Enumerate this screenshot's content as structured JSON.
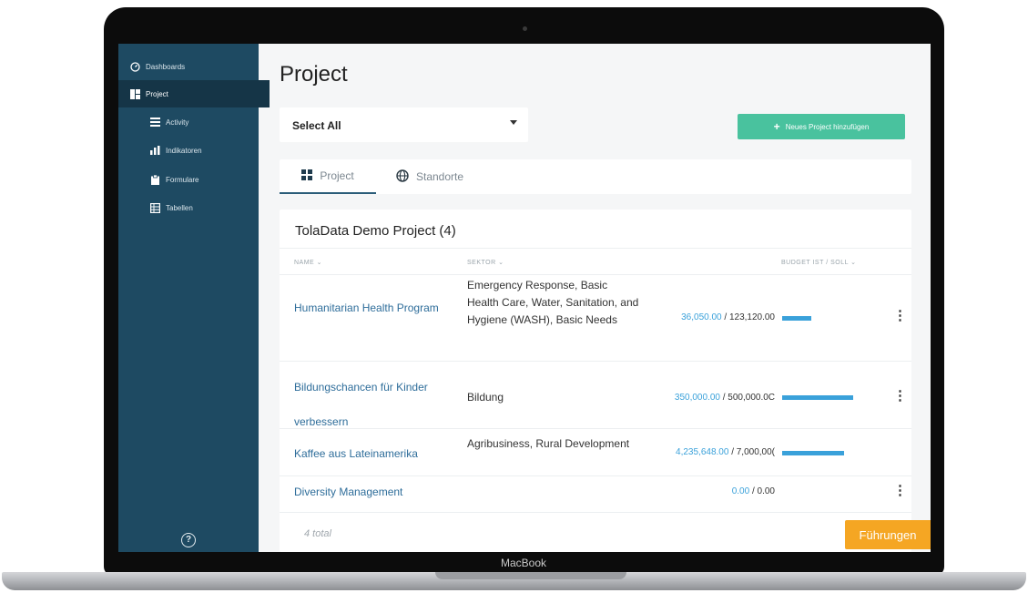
{
  "device": {
    "label": "MacBook"
  },
  "sidebar": {
    "items": [
      {
        "label": "Dashboards",
        "icon": "dashboard-icon"
      },
      {
        "label": "Project",
        "icon": "grid-icon"
      },
      {
        "label": "Activity",
        "icon": "list-icon"
      },
      {
        "label": "Indikatoren",
        "icon": "bar-chart-icon"
      },
      {
        "label": "Formulare",
        "icon": "clipboard-icon"
      },
      {
        "label": "Tabellen",
        "icon": "table-icon"
      }
    ],
    "help_icon": "help-icon"
  },
  "page": {
    "title": "Project"
  },
  "filter": {
    "selected": "Select All"
  },
  "actions": {
    "add_label": "Neues Project hinzufügen"
  },
  "tabs": [
    {
      "label": "Project",
      "icon": "grid-icon"
    },
    {
      "label": "Standorte",
      "icon": "globe-icon"
    }
  ],
  "card": {
    "title": "TolaData Demo Project (4)",
    "columns": {
      "name": "NAME ⌄",
      "sektor": "SEKTOR ⌄",
      "budget": "BUDGET IST / SOLL ⌄"
    },
    "rows": [
      {
        "name": "Humanitarian Health Program",
        "sektor": "Emergency Response, Basic Health Care, Water, Sanitation, and Hygiene (WASH), Basic Needs",
        "ist": "36,050.00",
        "soll": "/ 123,120.00",
        "progress": 0.29
      },
      {
        "name": "Bildungschancen für Kinder verbessern",
        "sektor": "Bildung",
        "ist": "350,000.00",
        "soll": "/ 500,000.0C",
        "progress": 0.7
      },
      {
        "name": "Kaffee aus Lateinamerika",
        "sektor": "Agribusiness, Rural Development",
        "ist": "4,235,648.00",
        "soll": "/ 7,000,00(",
        "progress": 0.61
      },
      {
        "name": "Diversity Management",
        "sektor": "",
        "ist": "0.00",
        "soll": "/ 0.00",
        "progress": 0
      }
    ],
    "total": "4 total"
  },
  "guide": {
    "label": "Führungen"
  },
  "colors": {
    "sidebar": "#1e4a62",
    "accent_green": "#49c29e",
    "accent_orange": "#f5a623",
    "link": "#2e6d9a",
    "bar": "#3aa1da"
  }
}
